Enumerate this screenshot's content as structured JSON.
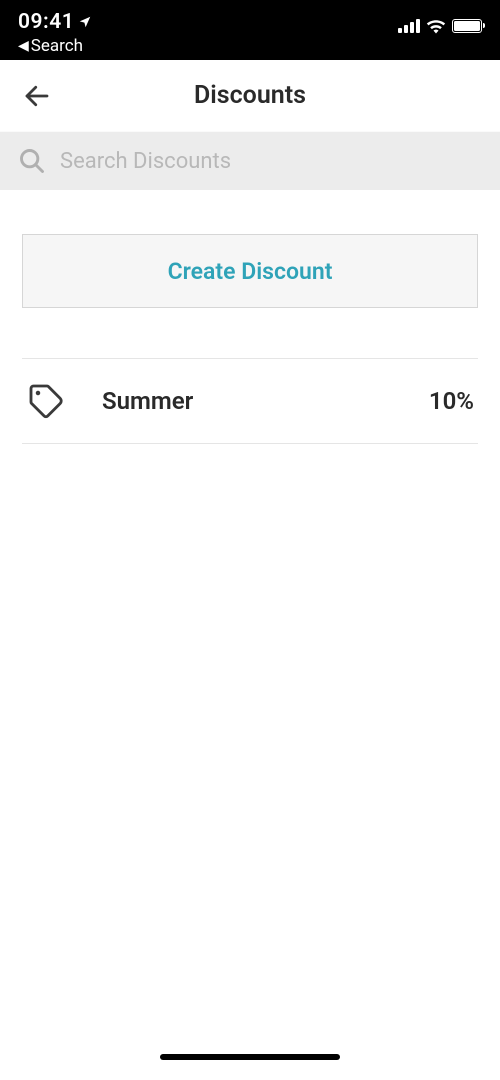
{
  "status": {
    "time": "09:41",
    "back_label": "Search"
  },
  "header": {
    "title": "Discounts"
  },
  "search": {
    "placeholder": "Search Discounts",
    "value": ""
  },
  "actions": {
    "create_label": "Create Discount"
  },
  "discounts": [
    {
      "name": "Summer",
      "value": "10%"
    }
  ]
}
